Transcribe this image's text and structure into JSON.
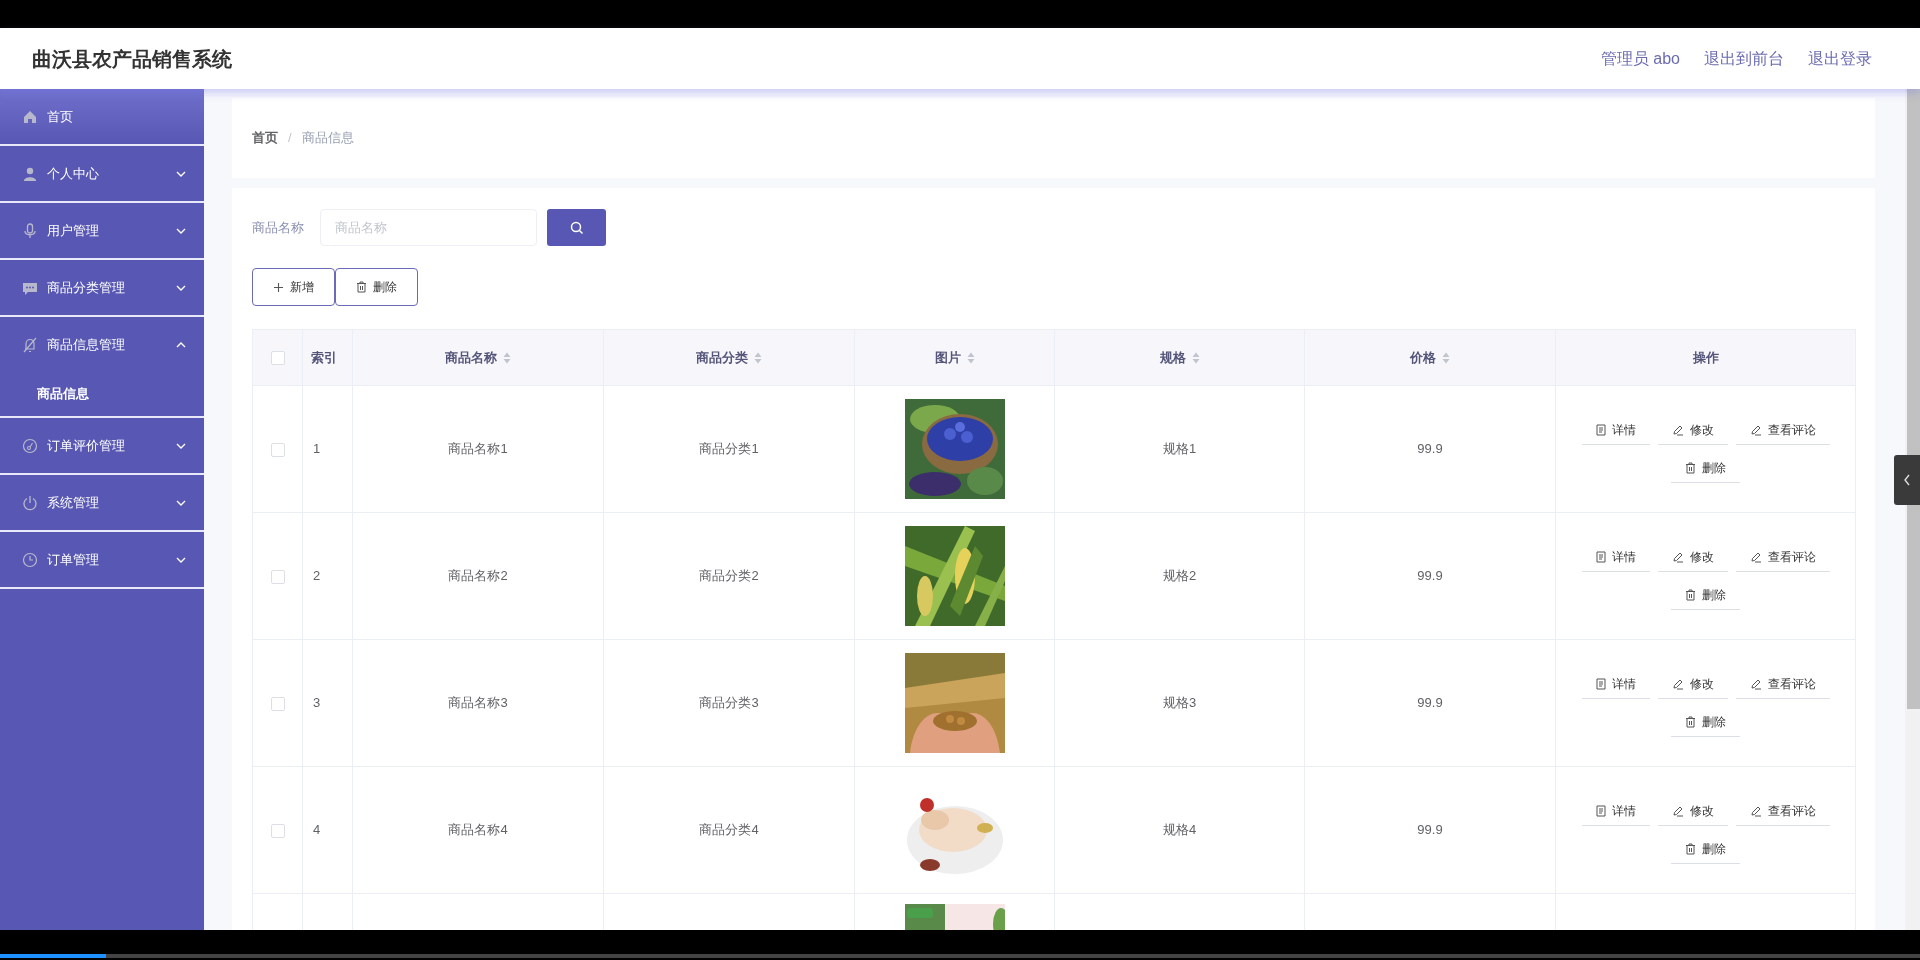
{
  "header": {
    "title": "曲沃县农产品销售系统",
    "links": [
      "管理员 abo",
      "退出到前台",
      "退出登录"
    ]
  },
  "sidebar": {
    "items": [
      {
        "kind": "link",
        "label": "首页"
      },
      {
        "kind": "menu",
        "label": "个人中心",
        "expanded": false
      },
      {
        "kind": "menu",
        "label": "用户管理",
        "expanded": false
      },
      {
        "kind": "menu",
        "label": "商品分类管理",
        "expanded": false
      },
      {
        "kind": "menu",
        "label": "商品信息管理",
        "expanded": true,
        "children": [
          {
            "label": "商品信息",
            "selected": true
          }
        ]
      },
      {
        "kind": "menu",
        "label": "订单评价管理",
        "expanded": false
      },
      {
        "kind": "menu",
        "label": "系统管理",
        "expanded": false
      },
      {
        "kind": "menu",
        "label": "订单管理",
        "expanded": false
      }
    ]
  },
  "breadcrumb": {
    "separator": "/",
    "items": [
      "首页",
      "商品信息"
    ]
  },
  "search": {
    "label": "商品名称",
    "placeholder": "商品名称"
  },
  "buttons": [
    {
      "kind": "add",
      "label": "新增"
    },
    {
      "kind": "delete",
      "label": "删除"
    }
  ],
  "table": {
    "columns": [
      {
        "kind": "checkbox",
        "checked": false
      },
      {
        "label": "索引",
        "sortable": false
      },
      {
        "label": "商品名称",
        "sortable": true
      },
      {
        "label": "商品分类",
        "sortable": true
      },
      {
        "label": "图片",
        "sortable": true
      },
      {
        "label": "规格",
        "sortable": true
      },
      {
        "label": "价格",
        "sortable": true
      },
      {
        "label": "操作",
        "sortable": false
      }
    ],
    "rows": [
      {
        "checked": false,
        "index": "1",
        "name": "商品名称1",
        "category": "商品分类1",
        "image": {
          "kind": "picture"
        },
        "spec": "规格1",
        "price": "99.9",
        "actions": [
          {
            "kind": "detail",
            "label": "详情"
          },
          {
            "kind": "edit",
            "label": "修改"
          },
          {
            "kind": "edit",
            "label": "查看评论"
          },
          {
            "kind": "delete",
            "label": "删除"
          }
        ]
      },
      {
        "checked": false,
        "index": "2",
        "name": "商品名称2",
        "category": "商品分类2",
        "image": {
          "kind": "picture"
        },
        "spec": "规格2",
        "price": "99.9",
        "actions": [
          {
            "kind": "detail",
            "label": "详情"
          },
          {
            "kind": "edit",
            "label": "修改"
          },
          {
            "kind": "edit",
            "label": "查看评论"
          },
          {
            "kind": "delete",
            "label": "删除"
          }
        ]
      },
      {
        "checked": false,
        "index": "3",
        "name": "商品名称3",
        "category": "商品分类3",
        "image": {
          "kind": "picture"
        },
        "spec": "规格3",
        "price": "99.9",
        "actions": [
          {
            "kind": "detail",
            "label": "详情"
          },
          {
            "kind": "edit",
            "label": "修改"
          },
          {
            "kind": "edit",
            "label": "查看评论"
          },
          {
            "kind": "delete",
            "label": "删除"
          }
        ]
      },
      {
        "checked": false,
        "index": "4",
        "name": "商品名称4",
        "category": "商品分类4",
        "image": {
          "kind": "picture"
        },
        "spec": "规格4",
        "price": "99.9",
        "actions": [
          {
            "kind": "detail",
            "label": "详情"
          },
          {
            "kind": "edit",
            "label": "修改"
          },
          {
            "kind": "edit",
            "label": "查看评论"
          },
          {
            "kind": "delete",
            "label": "删除"
          }
        ]
      },
      {
        "image": {
          "kind": "picture"
        }
      }
    ]
  },
  "player": {
    "level": 0.055
  }
}
